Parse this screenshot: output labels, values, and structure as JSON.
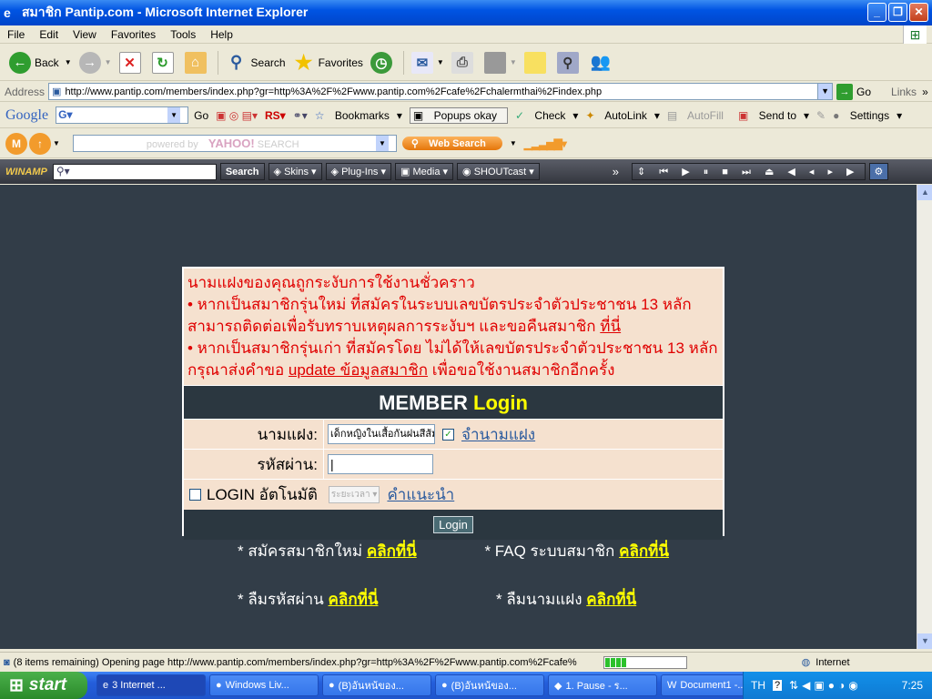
{
  "window": {
    "title": "สมาชิก Pantip.com - Microsoft Internet Explorer",
    "minimize": "_",
    "maximize": "❐",
    "close": "✕"
  },
  "menu": [
    "File",
    "Edit",
    "View",
    "Favorites",
    "Tools",
    "Help"
  ],
  "toolbar": {
    "back": "Back",
    "search": "Search",
    "favorites": "Favorites"
  },
  "address": {
    "label": "Address",
    "url": "http://www.pantip.com/members/index.php?gr=http%3A%2F%2Fwww.pantip.com%2Fcafe%2Fchalermthai%2Findex.php",
    "go": "Go",
    "links": "Links"
  },
  "google": {
    "logo": "Google",
    "go": "Go",
    "bookmarks": "Bookmarks",
    "popups": "Popups okay",
    "check": "Check",
    "autolink": "AutoLink",
    "autofill": "AutoFill",
    "sendto": "Send to",
    "settings": "Settings"
  },
  "yahoo": {
    "placeholder_prefix": "powered by",
    "placeholder_brand": "YAHOO!",
    "placeholder_suffix": "SEARCH",
    "websearch": "Web Search"
  },
  "winamp": {
    "logo": "WINAMP",
    "search": "Search",
    "skins": "Skins",
    "plugins": "Plug-Ins",
    "media": "Media",
    "shoutcast": "SHOUTcast"
  },
  "login": {
    "warning_line1": "นามแฝงของคุณถูกระงับการใช้งานชั่วคราว",
    "warning_line2": "• หากเป็นสมาชิกรุ่นใหม่ ที่สมัครในระบบเลขบัตรประจำตัวประชาชน 13 หลัก สามารถติดต่อเพื่อรับทราบเหตุผลการระงับฯ และขอคืนสมาชิก ",
    "warning_link1": "ที่นี่",
    "warning_line3": "• หากเป็นสมาชิกรุ่นเก่า ที่สมัครโดย ไม่ได้ให้เลขบัตรประจำตัวประชาชน 13 หลัก กรุณาส่งคำขอ ",
    "warning_link2": "update ข้อมูลสมาชิก",
    "warning_line3_end": " เพื่อขอใช้งานสมาชิกอีกครั้ง",
    "header_member": "MEMBER",
    "header_login": "Login",
    "username_label": "นามแฝง:",
    "username_value": "เด็กหญิงในเสื้อกันฝนสีส้ม",
    "remember_label": "จำนามแฝง",
    "password_label": "รหัสผ่าน:",
    "auto_login_label": "LOGIN อัตโนมัติ",
    "duration_select": "ระยะเวลา",
    "advice_link": "คำแนะนำ",
    "login_button": "Login"
  },
  "footer_links": {
    "register_text": "* สมัครสมาชิกใหม่ ",
    "register_link": "คลิกที่นี่",
    "faq_text": "* FAQ ระบบสมาชิก ",
    "faq_link": "คลิกที่นี่",
    "forgot_pw_text": "* ลืมรหัสผ่าน ",
    "forgot_pw_link": "คลิกที่นี่",
    "forgot_name_text": "* ลืมนามแฝง ",
    "forgot_name_link": "คลิกที่นี่"
  },
  "status": {
    "text": "(8 items remaining) Opening page http://www.pantip.com/members/index.php?gr=http%3A%2F%2Fwww.pantip.com%2Fcafe%",
    "zone": "Internet",
    "progress": 0.2
  },
  "taskbar": {
    "start": "start",
    "tasks": [
      "3 Internet ...",
      "Windows Liv...",
      "(B)อันหน้ของ...",
      "(B)อันหน้ของ...",
      "1. Pause - ร...",
      "Document1 -..."
    ],
    "lang": "TH",
    "clock": "7:25"
  }
}
